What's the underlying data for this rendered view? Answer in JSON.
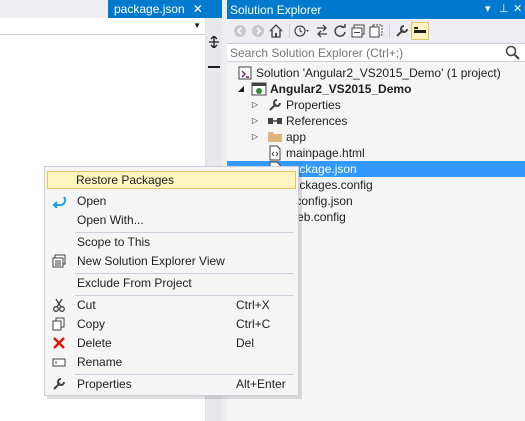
{
  "editor": {
    "tab_title": "package.json",
    "tab_close": "✕",
    "tab_dropdown": "▼"
  },
  "solution_explorer": {
    "title": "Solution Explorer",
    "title_buttons": [
      "▾",
      "⊥",
      "✕"
    ],
    "search_placeholder": "Search Solution Explorer (Ctrl+;)",
    "tree": [
      {
        "label": "Solution 'Angular2_VS2015_Demo' (1 project)",
        "icon": "solution-icon",
        "indent": 1,
        "arrow": ""
      },
      {
        "label": "Angular2_VS2015_Demo",
        "icon": "web-project-icon",
        "indent": 1,
        "arrow": "expanded",
        "bold": true
      },
      {
        "label": "Properties",
        "icon": "wrench-icon",
        "indent": 2,
        "arrow": "collapsed"
      },
      {
        "label": "References",
        "icon": "references-icon",
        "indent": 2,
        "arrow": "collapsed"
      },
      {
        "label": "app",
        "icon": "folder-icon",
        "indent": 2,
        "arrow": "collapsed"
      },
      {
        "label": "mainpage.html",
        "icon": "html-file-icon",
        "indent": 2,
        "arrow": ""
      },
      {
        "label": "package.json",
        "icon": "json-file-icon",
        "indent": 2,
        "arrow": "",
        "selected": true
      },
      {
        "label": "packages.config",
        "icon": "config-file-icon",
        "indent": 2,
        "arrow": ""
      },
      {
        "label": "tsconfig.json",
        "icon": "json-file-icon",
        "indent": 2,
        "arrow": ""
      },
      {
        "label": "Web.config",
        "icon": "config-file-icon",
        "indent": 2,
        "arrow": ""
      }
    ]
  },
  "context_menu": {
    "items": [
      {
        "label": "Restore Packages",
        "shortcut": "",
        "icon": "",
        "highlighted": true
      },
      {
        "label": "Open",
        "shortcut": "",
        "icon": "open-arrow-icon"
      },
      {
        "label": "Open With...",
        "shortcut": "",
        "icon": ""
      },
      {
        "label": "Scope to This",
        "shortcut": "",
        "icon": ""
      },
      {
        "label": "New Solution Explorer View",
        "shortcut": "",
        "icon": "new-view-icon"
      },
      {
        "label": "Exclude From Project",
        "shortcut": "",
        "icon": ""
      },
      {
        "label": "Cut",
        "shortcut": "Ctrl+X",
        "icon": "scissors-icon"
      },
      {
        "label": "Copy",
        "shortcut": "Ctrl+C",
        "icon": "copy-icon"
      },
      {
        "label": "Delete",
        "shortcut": "Del",
        "icon": "delete-x-icon"
      },
      {
        "label": "Rename",
        "shortcut": "",
        "icon": "rename-icon"
      },
      {
        "label": "Properties",
        "shortcut": "Alt+Enter",
        "icon": "wrench-icon"
      }
    ]
  },
  "colors": {
    "accent": "#007acc",
    "selection": "#3399ff",
    "menu_highlight": "#fdf4bf",
    "delete_red": "#e51400"
  }
}
